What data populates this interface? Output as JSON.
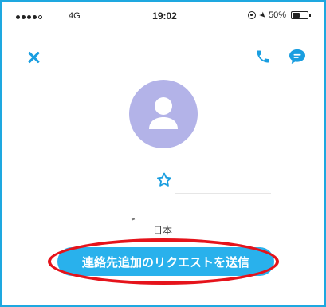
{
  "status_bar": {
    "carrier": "4G",
    "time": "19:02",
    "battery_text": "50%",
    "battery_level": 0.5
  },
  "profile": {
    "country": "日本"
  },
  "actions": {
    "request_button_label": "連絡先追加のリクエストを送信"
  },
  "colors": {
    "accent": "#1a9ee0",
    "button": "#29b1ec",
    "avatar_bg": "#b3b3e8",
    "highlight": "#e5131b"
  }
}
